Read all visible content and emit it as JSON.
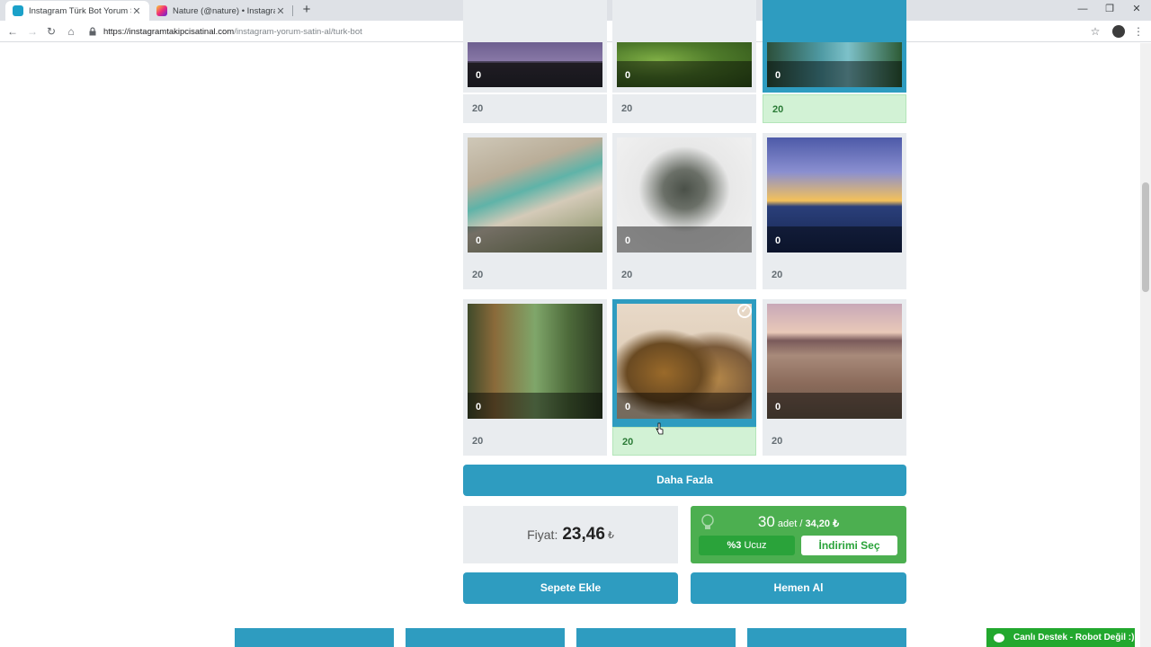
{
  "browser": {
    "tabs": [
      {
        "title": "Instagram Türk Bot Yorum Satın Al",
        "active": true,
        "icon": "instagram-tool-favicon"
      },
      {
        "title": "Nature (@nature) • Instagram fotoğraf",
        "active": false,
        "icon": "instagram-favicon"
      }
    ],
    "new_tab": "+",
    "window_controls": {
      "minimize": "—",
      "restore": "❐",
      "close": "✕"
    },
    "nav": {
      "back": "←",
      "forward": "→",
      "reload": "↻",
      "home": "⌂"
    },
    "url_host": "https://instagramtakipcisatinal.com",
    "url_path": "/instagram-yorum-satin-al/turk-bot",
    "star": "☆",
    "menu": "⋮"
  },
  "posts": [
    {
      "overlay": "0",
      "count": "20",
      "selected": false
    },
    {
      "overlay": "0",
      "count": "20",
      "selected": false
    },
    {
      "overlay": "0",
      "count": "20",
      "selected": true
    },
    {
      "overlay": "0",
      "count": "20",
      "selected": false
    },
    {
      "overlay": "0",
      "count": "20",
      "selected": false
    },
    {
      "overlay": "0",
      "count": "20",
      "selected": false
    },
    {
      "overlay": "0",
      "count": "20",
      "selected": false
    },
    {
      "overlay": "0",
      "count": "20",
      "selected": true
    },
    {
      "overlay": "0",
      "count": "20",
      "selected": false
    }
  ],
  "check_mark": "✓",
  "more_button": "Daha Fazla",
  "price": {
    "label": "Fiyat:",
    "amount": "23,46",
    "currency": "₺"
  },
  "discount": {
    "quantity": "30",
    "unit": "adet /",
    "price": "34,20 ₺",
    "percent": "%3",
    "percent_label": "Ucuz",
    "select": "İndirimi Seç"
  },
  "add_to_cart": "Sepete Ekle",
  "buy_now": "Hemen Al",
  "live_support": "Canlı Destek - Robot Değil :)",
  "colors": {
    "primary": "#2e9cc0",
    "success": "#4caf50",
    "selected_count_bg": "#d2f2d5"
  }
}
